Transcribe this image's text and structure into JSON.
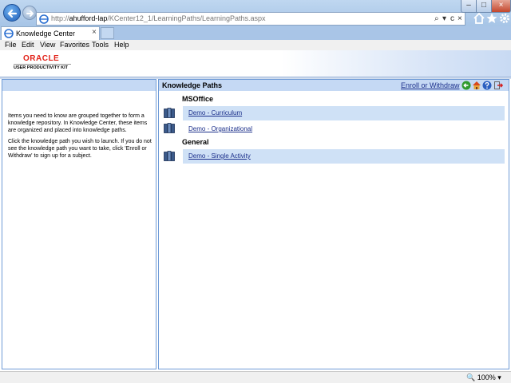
{
  "browser": {
    "address_prefix": "http://",
    "address_host": "ahufford-lap",
    "address_path": "/KCenter12_1/LearningPaths/LearningPaths.aspx",
    "tab_label": "Knowledge Center",
    "tab_close_glyph": "×",
    "search_glyph": "⌕",
    "dropdown_glyph": "▾",
    "refresh_glyph": "c",
    "stop_glyph": "×",
    "window_min_glyph": "–",
    "window_max_glyph": "□",
    "window_close_glyph": "×",
    "menu": [
      "File",
      "Edit",
      "View",
      "Favorites",
      "Tools",
      "Help"
    ],
    "zoom": "100%",
    "icons": [
      "back-arrow-icon",
      "forward-arrow-icon",
      "home-icon",
      "star-icon",
      "gear-icon"
    ]
  },
  "header": {
    "logo_text": "ORACLE",
    "product_name": "USER PRODUCTIVITY KIT"
  },
  "left_pane": {
    "intro_text": "Items you need to know are grouped together to form a knowledge repository. In Knowledge Center, these items are organized and placed into knowledge paths.",
    "instruction_text": "Click the knowledge path you wish to launch. If you do not see the knowledge path you want to take, click 'Enroll or Withdraw' to sign up for a subject."
  },
  "knowledge_paths": {
    "title": "Knowledge Paths",
    "enroll_label": "Enroll or Withdraw",
    "header_icons": [
      "go-arrow-icon",
      "home-icon",
      "help-icon",
      "exit-icon"
    ],
    "groups": [
      {
        "name": "MSOffice",
        "paths": [
          "Demo - Curriculum",
          "Demo - Organizational"
        ]
      },
      {
        "name": "General",
        "paths": [
          "Demo - Single Activity"
        ]
      }
    ]
  },
  "colors": {
    "accent_blue": "#1a2e8a",
    "pane_header": "#c5d9f4",
    "row_highlight": "#cfe1f6",
    "oracle_red": "#e2231a"
  }
}
